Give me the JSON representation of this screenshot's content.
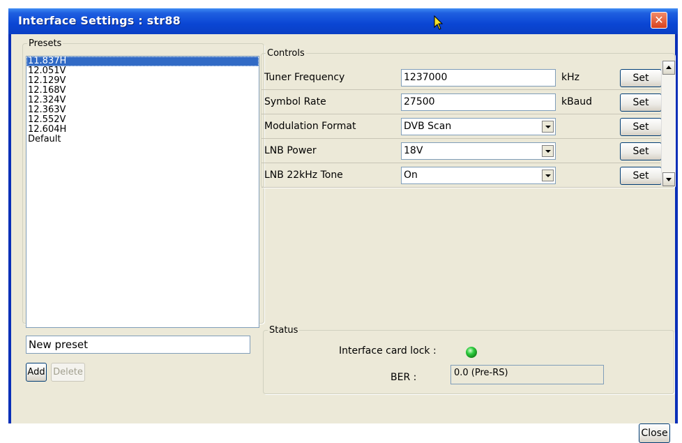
{
  "window": {
    "title": "Interface Settings : str88"
  },
  "presets": {
    "legend": "Presets",
    "items": [
      "11.837H",
      "12.051V",
      "12.129V",
      "12.168V",
      "12.324V",
      "12.363V",
      "12.552V",
      "12.604H",
      "Default"
    ],
    "selected_index": 0,
    "name_field_value": "New preset",
    "add_label": "Add",
    "delete_label": "Delete"
  },
  "controls": {
    "legend": "Controls",
    "rows": [
      {
        "label": "Tuner Frequency",
        "kind": "text",
        "value": "1237000",
        "unit": "kHz",
        "set_label": "Set"
      },
      {
        "label": "Symbol Rate",
        "kind": "text",
        "value": "27500",
        "unit": "kBaud",
        "set_label": "Set"
      },
      {
        "label": "Modulation Format",
        "kind": "select",
        "value": "DVB Scan",
        "unit": "",
        "set_label": "Set"
      },
      {
        "label": "LNB Power",
        "kind": "select",
        "value": "18V",
        "unit": "",
        "set_label": "Set"
      },
      {
        "label": "LNB 22kHz Tone",
        "kind": "select",
        "value": "On",
        "unit": "",
        "set_label": "Set"
      }
    ]
  },
  "status": {
    "legend": "Status",
    "lock_label": "Interface card lock :",
    "lock_color": "#2ecc40",
    "ber_label": "BER :",
    "ber_value": "0.0  (Pre-RS)"
  },
  "footer": {
    "close_label": "Close"
  },
  "icons": {
    "cursor": "mouse-pointer-icon",
    "title_close": "close-icon"
  }
}
